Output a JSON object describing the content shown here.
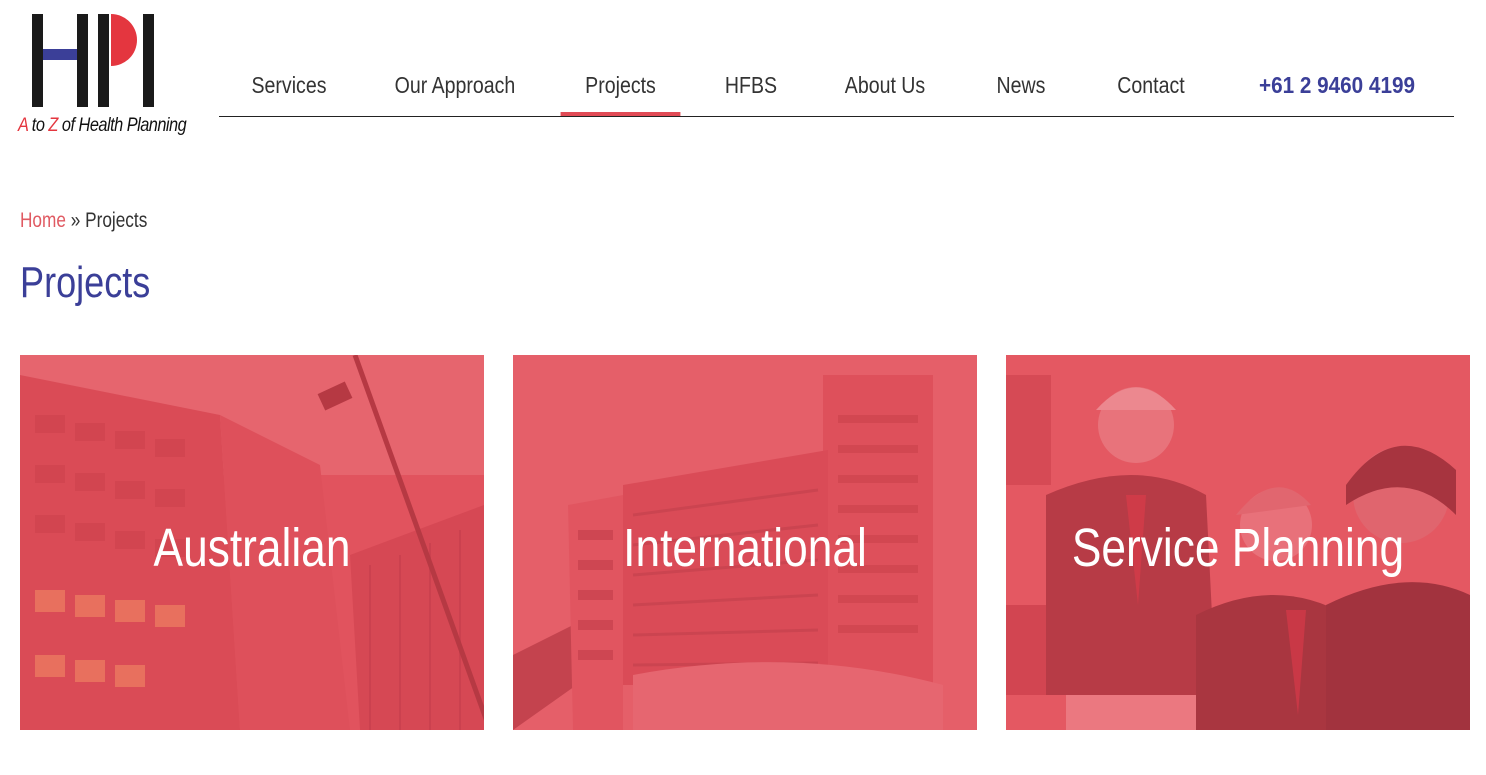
{
  "header": {
    "logo": {
      "letters": "HPI",
      "tagline": {
        "a": "A",
        "to": " to ",
        "z": "Z",
        "rest": " of Health Planning"
      },
      "colors": {
        "black": "#1a1a1a",
        "blue": "#3b3f98",
        "red": "#e4363f"
      }
    },
    "nav": {
      "items": [
        {
          "label": "Services",
          "active": false
        },
        {
          "label": "Our Approach",
          "active": false
        },
        {
          "label": "Projects",
          "active": true
        },
        {
          "label": "HFBS",
          "active": false
        },
        {
          "label": "About Us",
          "active": false
        },
        {
          "label": "News",
          "active": false
        },
        {
          "label": "Contact",
          "active": false
        }
      ],
      "phone": "+61 2 9460 4199"
    }
  },
  "breadcrumb": {
    "home": "Home",
    "separator": " » ",
    "current": "Projects"
  },
  "page": {
    "title": "Projects"
  },
  "tiles": [
    {
      "label": "Australian",
      "image_icon": "building-photo"
    },
    {
      "label": "International",
      "image_icon": "hospital-photo"
    },
    {
      "label": "Service Planning",
      "image_icon": "meeting-photo"
    }
  ],
  "colors": {
    "accent_red": "#e14b56",
    "brand_blue": "#3b3f98",
    "tile_overlay": "#e84854"
  }
}
